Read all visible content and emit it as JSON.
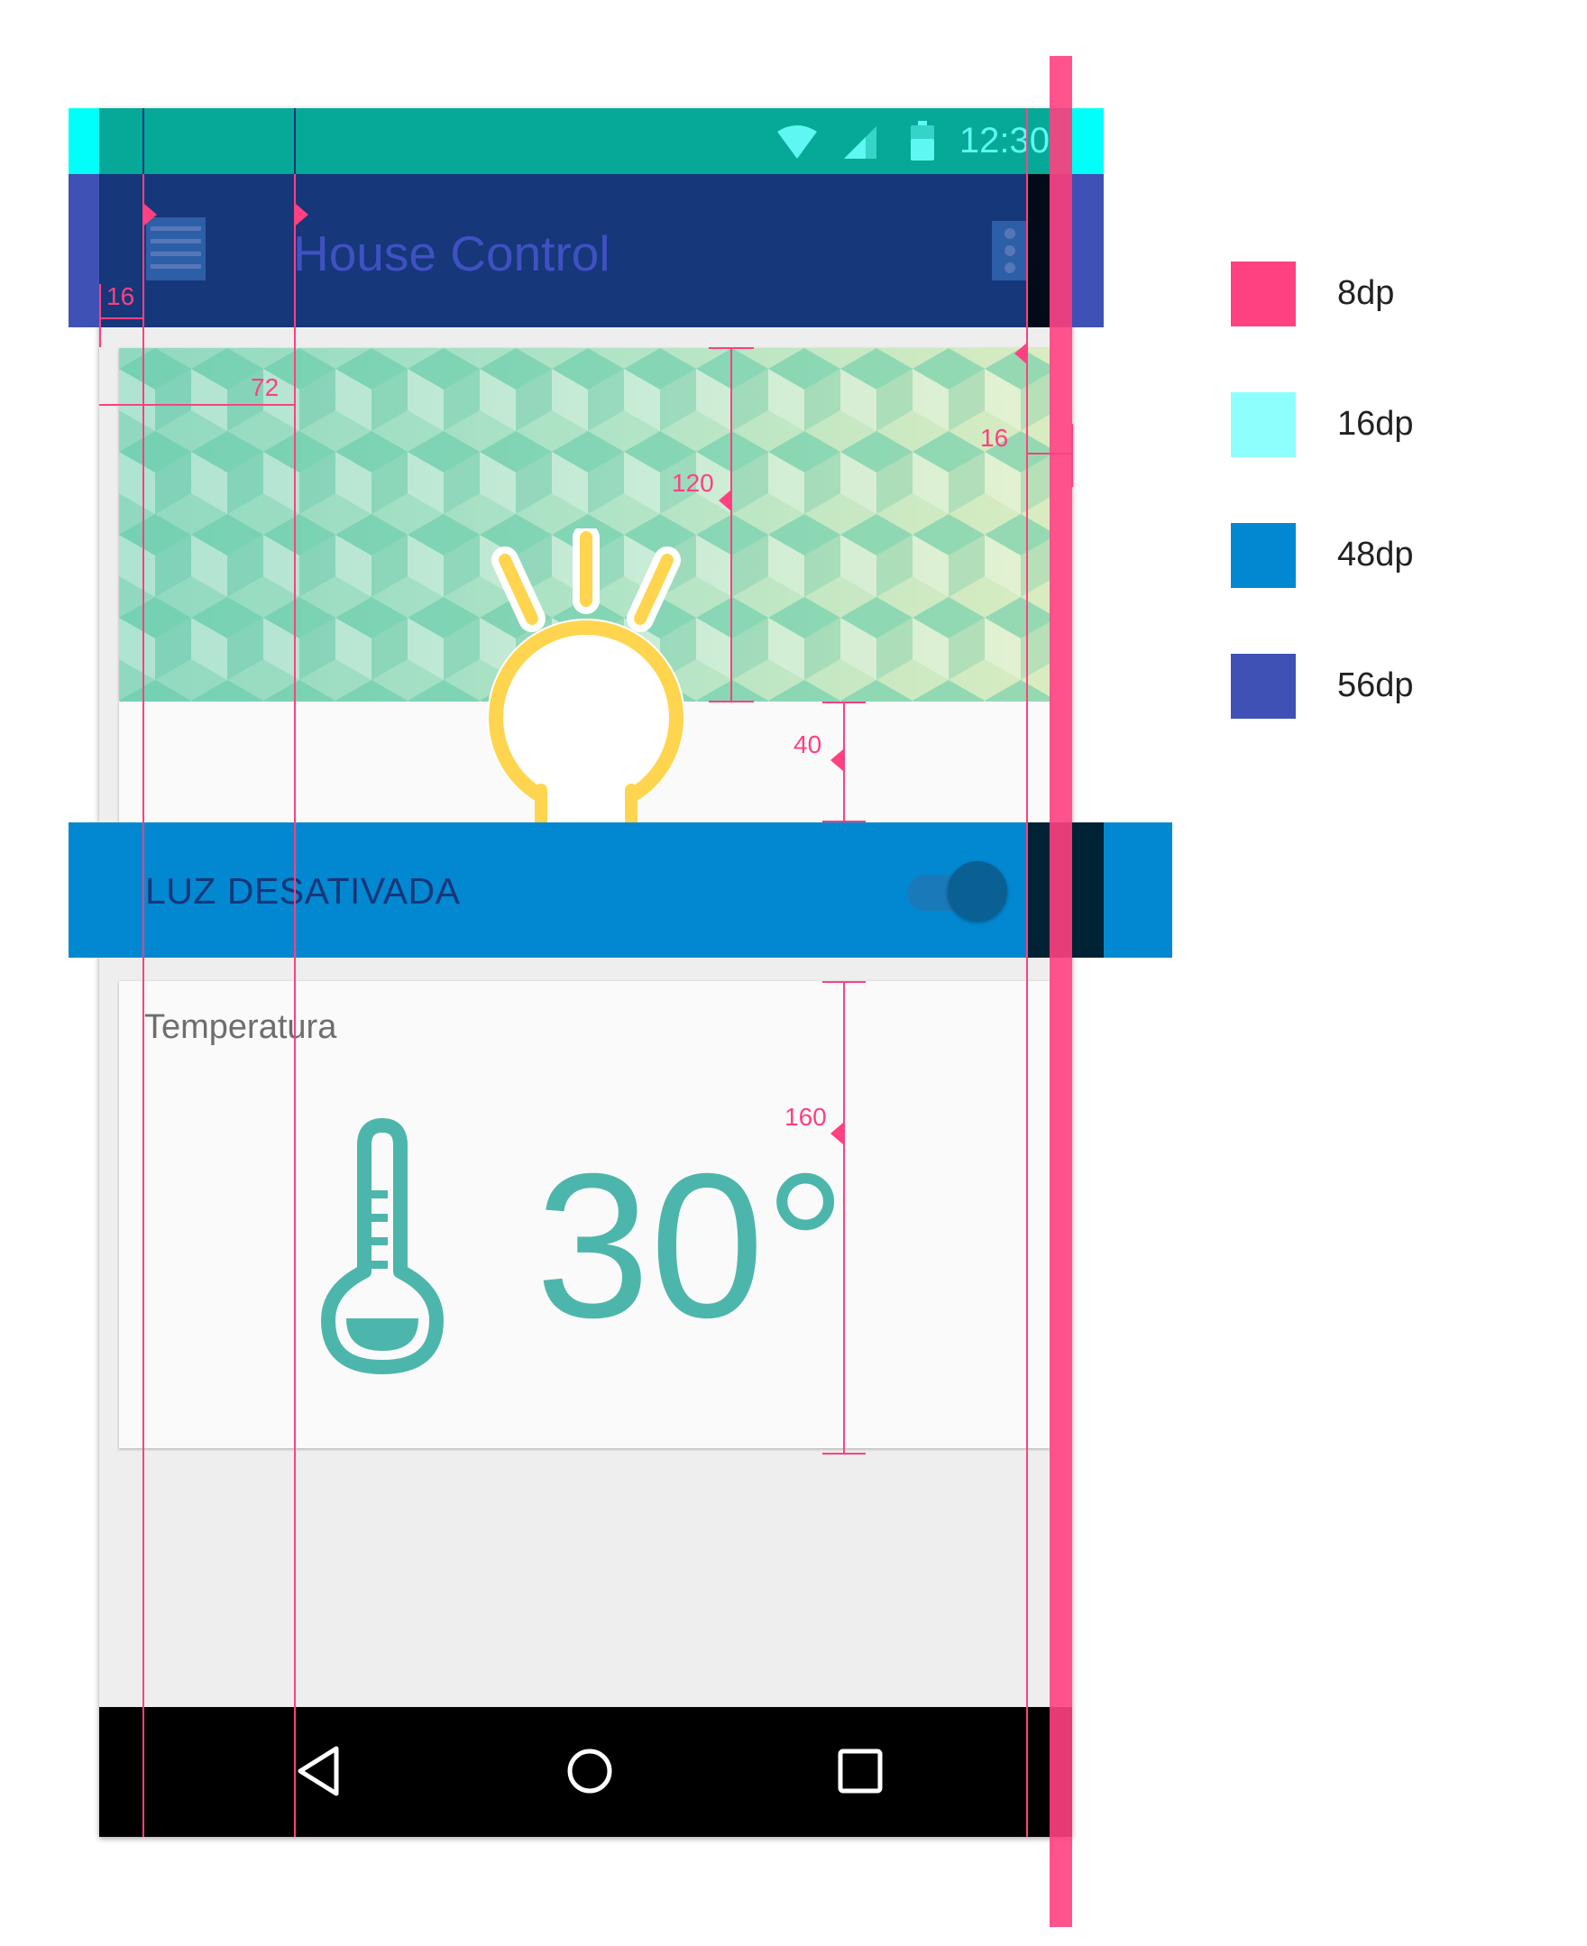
{
  "status_bar": {
    "time": "12:30",
    "icons": [
      "wifi-icon",
      "signal-icon",
      "battery-icon"
    ]
  },
  "app_bar": {
    "title": "House Control",
    "nav_icon": "menu-icon",
    "action_icon": "overflow-menu-icon"
  },
  "light_card": {
    "icon": "lightbulb-icon",
    "toggle_label": "LUZ DESATIVADA",
    "toggle_on": false
  },
  "temperature_card": {
    "title": "Temperatura",
    "value": "30°",
    "icon": "thermometer-icon"
  },
  "nav_bar": {
    "buttons": [
      "back-icon",
      "home-icon",
      "recents-icon"
    ]
  },
  "spec": {
    "dimensions": {
      "keyline_16": "16",
      "keyline_72": "72",
      "margin_right": "16",
      "hero_height": "120",
      "hero_gap": "40",
      "card_height": "160"
    },
    "legend": [
      {
        "label": "8dp",
        "color": "#ff4081"
      },
      {
        "label": "16dp",
        "color": "#8dfffc"
      },
      {
        "label": "48dp",
        "color": "#0288d1"
      },
      {
        "label": "56dp",
        "color": "#3f51b5"
      }
    ]
  },
  "colors": {
    "status_bar": "#06a898",
    "app_bar": "#163779",
    "accent": "#ff4081",
    "teal": "#4db6ac",
    "bulb": "#ffd54f",
    "toggle_row": "#0288d1"
  }
}
